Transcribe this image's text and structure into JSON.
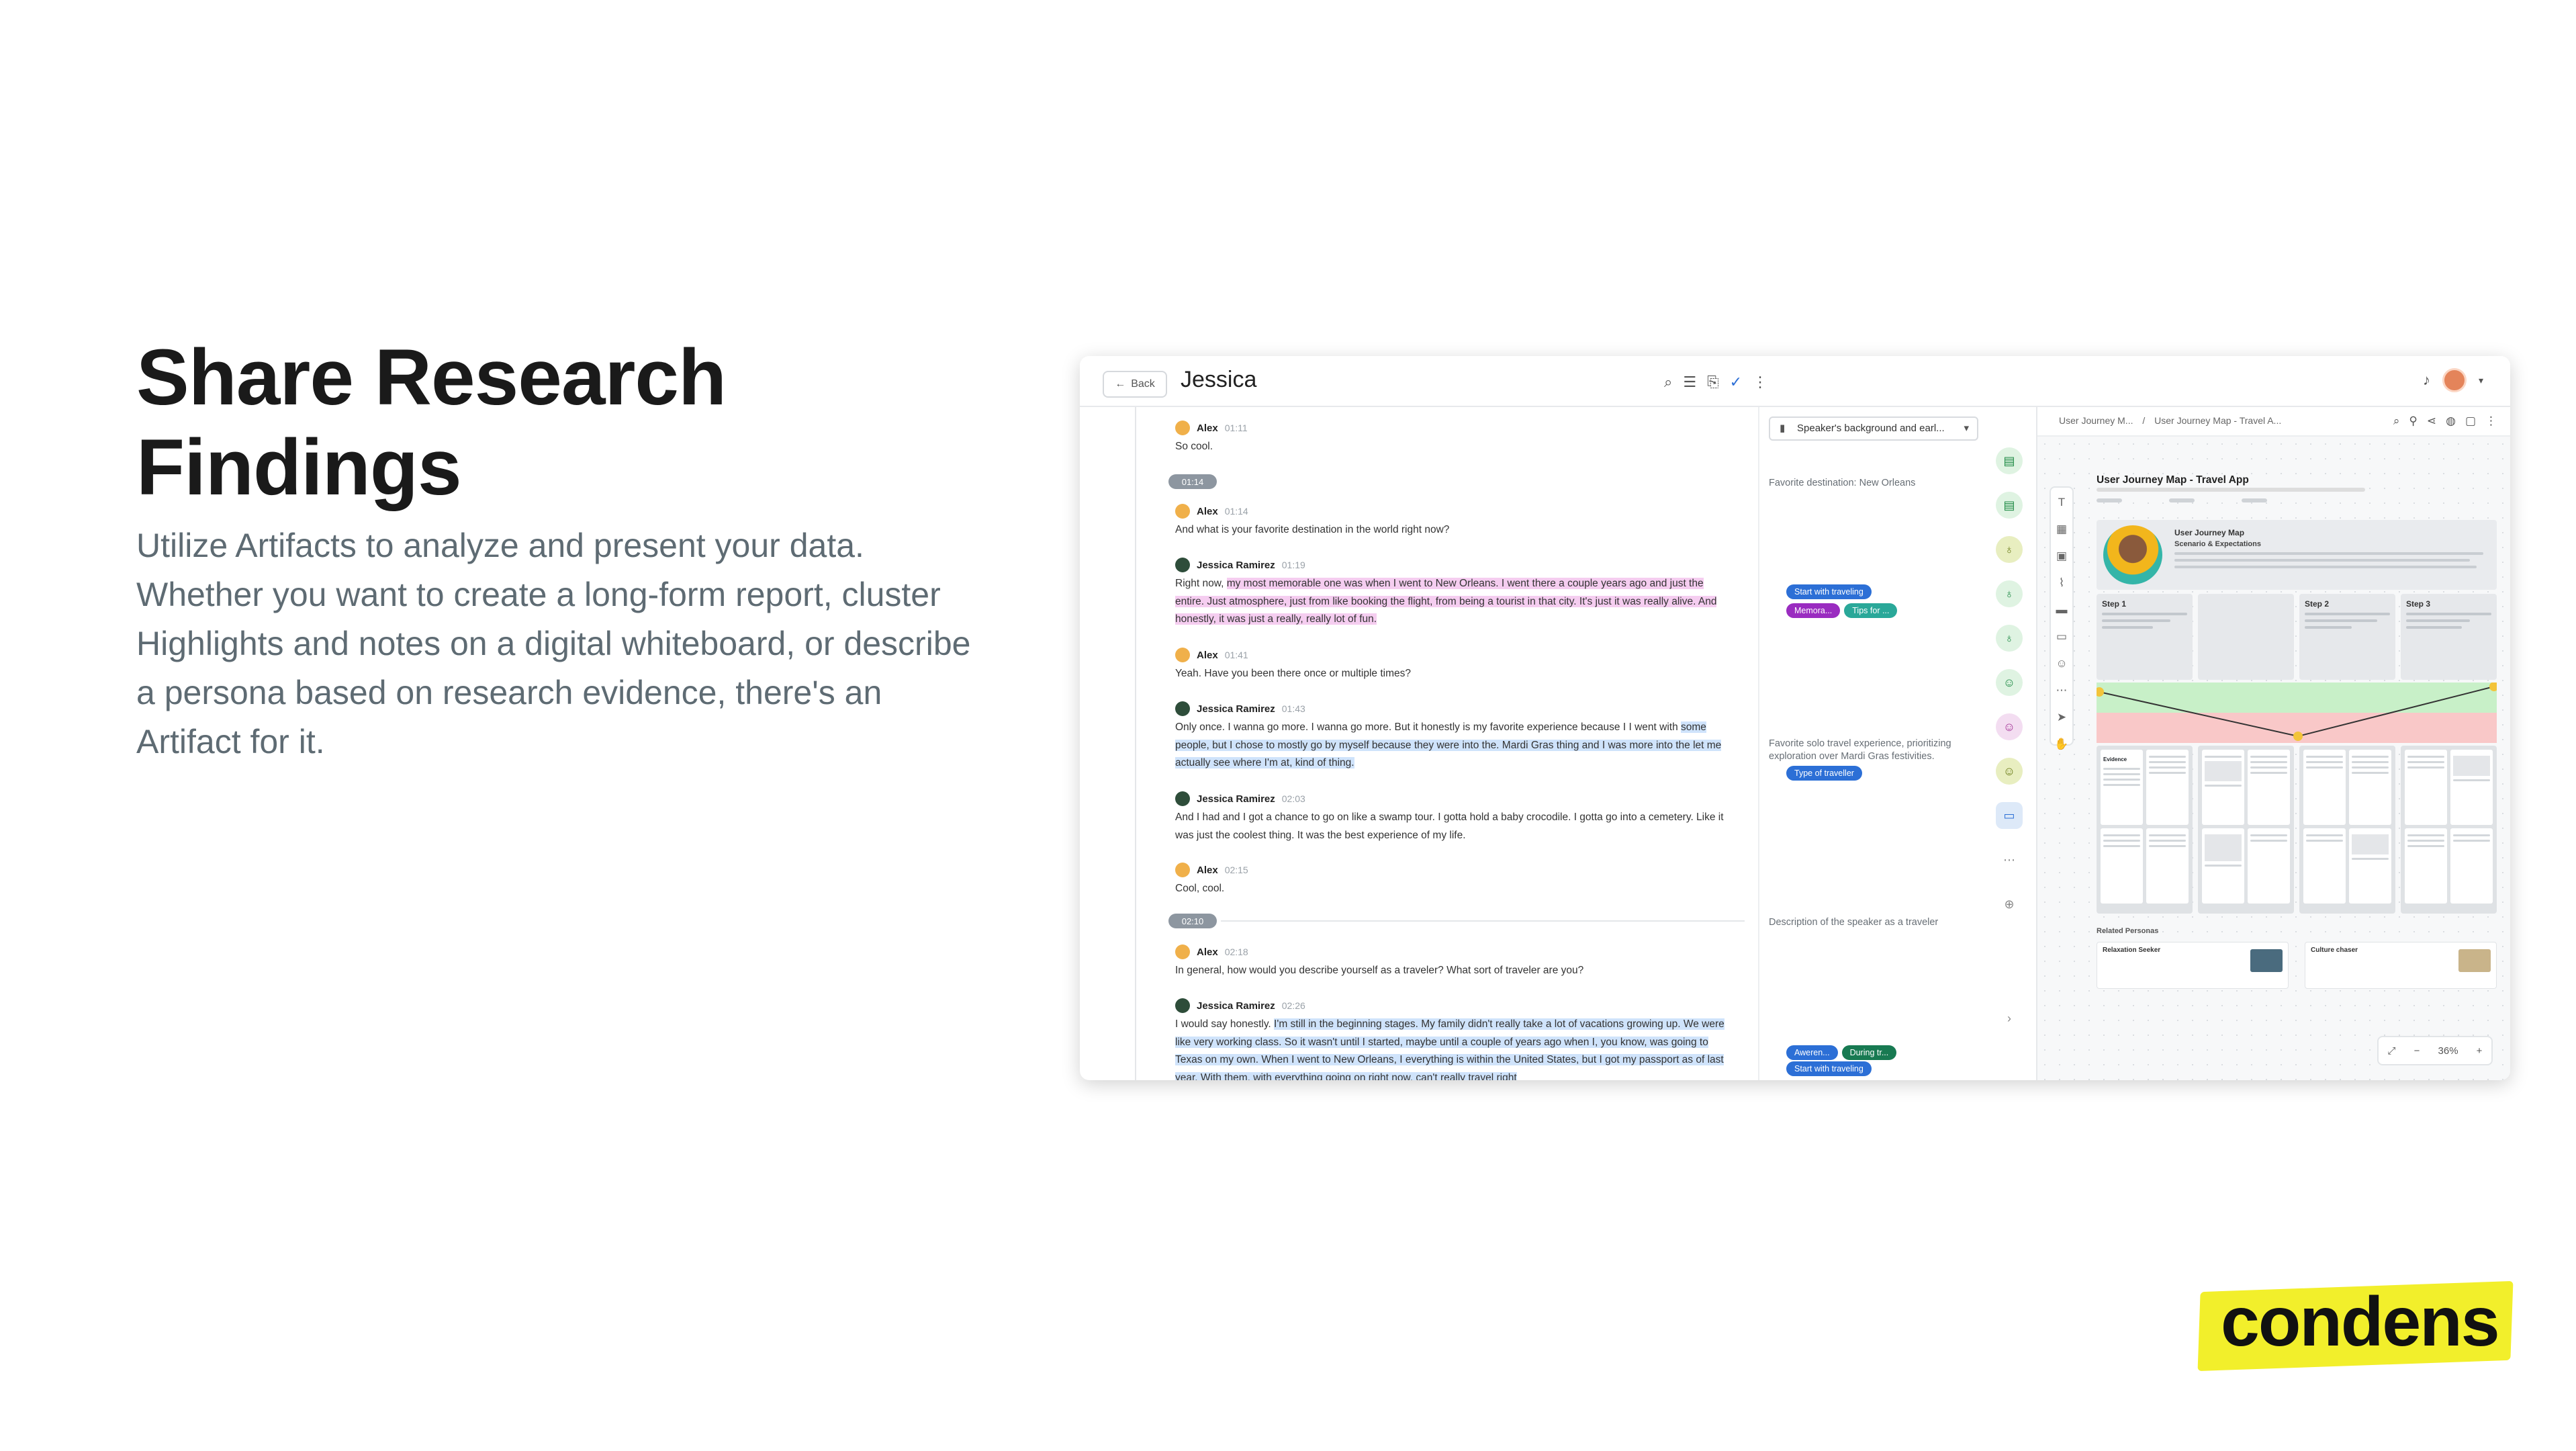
{
  "hero": {
    "headline_line1": "Share Research",
    "headline_line2": "Findings",
    "subcopy": "Utilize Artifacts to analyze and present your data. Whether you want to create a long-form report, cluster Highlights and notes on a digital whiteboard, or describe a persona based on research evidence, there's an Artifact for it."
  },
  "logo": {
    "text": "condens",
    "color": "#f2ef2b"
  },
  "app": {
    "back_label": "Back",
    "title": "Jessica",
    "transcript": {
      "messages": [
        {
          "speaker": "Alex",
          "time": "01:11",
          "text": "So cool."
        },
        {
          "speaker": "Alex",
          "time": "01:14",
          "text": "And what is your favorite destination in the world right now?"
        },
        {
          "speaker": "Jessica Ramirez",
          "time": "01:19",
          "text_1": "Right now, ",
          "text_hl": "my most memorable one was when I went to New Orleans. I went there a couple years ago and just the entire. Just atmosphere, just from like booking the flight, from being a tourist in that city. It's just it was really alive. And honestly, it was just a really, really lot of fun."
        },
        {
          "speaker": "Alex",
          "time": "01:41",
          "text": "Yeah. Have you been there once or multiple times?"
        },
        {
          "speaker": "Jessica Ramirez",
          "time": "01:43",
          "text_1": "Only once. I wanna go more. I wanna go more. But it honestly is my favorite experience because I I went with ",
          "text_hl": "some people, but I chose to mostly go by myself because they were into the. Mardi Gras thing and I was more into the let me actually see where I'm at, kind of thing."
        },
        {
          "speaker": "Jessica Ramirez",
          "time": "02:03",
          "text": " And I had and I got a chance to go on like a swamp tour. I gotta hold a baby crocodile. I gotta go into a cemetery. Like it was just the coolest thing. It was the best experience of my life."
        },
        {
          "speaker": "Alex",
          "time": "02:15",
          "text": "Cool, cool."
        },
        {
          "speaker": "Alex",
          "time": "02:18",
          "text": "In general, how would you describe yourself as a traveler? What sort of traveler are you?"
        },
        {
          "speaker": "Jessica Ramirez",
          "time": "02:26",
          "text_1": "I would say honestly. ",
          "text_hl": "I'm still in the beginning stages. My family didn't really take a lot of vacations growing up. We were like very working class. So it wasn't until I started, maybe until a couple of years ago when I, you know, was going to Texas on my own. When I went to New Orleans, I everything is within the United States, but I got my passport as of last year. With them, with everything going on right now, can't really travel right"
        }
      ],
      "markers": [
        "01:14",
        "02:10"
      ]
    },
    "tags": {
      "filter_label": "Speaker's background and earl...",
      "note_1": "Favorite destination: New Orleans",
      "chips_1": [
        "Start with traveling"
      ],
      "chips_2": [
        "Memora...",
        "Tips for ..."
      ],
      "note_2": "Favorite solo travel experience, prioritizing exploration over Mardi Gras festivities.",
      "chips_3": [
        "Type of traveller"
      ],
      "note_3": "Description of the speaker as a traveler",
      "chips_4": [
        "Aweren...",
        "During tr..."
      ],
      "chips_5": [
        "Start with traveling"
      ]
    },
    "board": {
      "breadcrumb_1": "User Journey M...",
      "breadcrumb_2": "User Journey Map - Travel A...",
      "journey_title": "User Journey Map - Travel App",
      "persona_title": "User Journey Map",
      "persona_sub": "Scenario & Expectations",
      "steps": [
        "Step 1",
        "Step 2",
        "Step 3"
      ],
      "evidence_label": "Evidence",
      "related_label": "Related Personas",
      "related": [
        "Relaxation Seeker",
        "Culture chaser"
      ],
      "zoom": "36%"
    }
  }
}
